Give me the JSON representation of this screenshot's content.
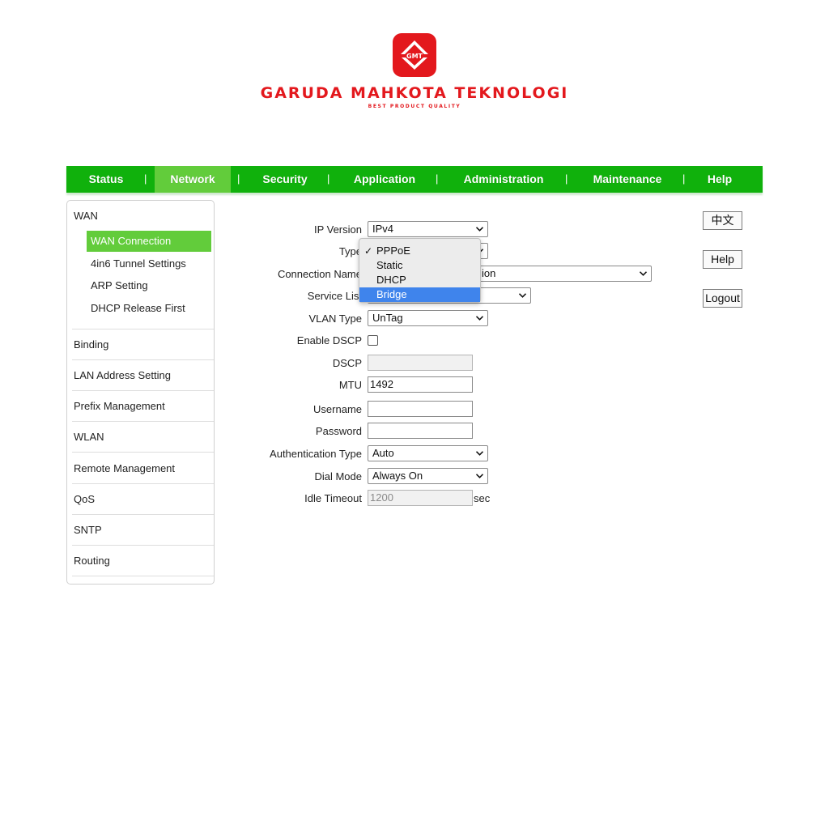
{
  "brand": {
    "logo_text": "GMT",
    "name": "GARUDA MAHKOTA TEKNOLOGI",
    "tagline": "BEST PRODUCT QUALITY",
    "color": "#e3181d"
  },
  "nav": {
    "items": [
      "Status",
      "Network",
      "Security",
      "Application",
      "Administration",
      "Maintenance",
      "Help"
    ],
    "separator": "|",
    "active": "Network",
    "bg_color": "#10b10c",
    "active_color": "#62cc3b"
  },
  "sidebar": {
    "wan": "WAN",
    "wan_items": [
      "WAN Connection",
      "4in6 Tunnel Settings",
      "ARP Setting",
      "DHCP Release First"
    ],
    "active_item": "WAN Connection",
    "groups": [
      "Binding",
      "LAN Address Setting",
      "Prefix Management",
      "WLAN",
      "Remote Management",
      "QoS",
      "SNTP",
      "Routing"
    ]
  },
  "form": {
    "ip_version": {
      "label": "IP Version",
      "value": "IPv4"
    },
    "type": {
      "label": "Type"
    },
    "connection_name": {
      "label": "Connection Name",
      "value_visible_fragment": "ion"
    },
    "service_list": {
      "label": "Service List"
    },
    "vlan_type": {
      "label": "VLAN Type",
      "value": "UnTag"
    },
    "enable_dscp": {
      "label": "Enable DSCP",
      "checked": false
    },
    "dscp": {
      "label": "DSCP",
      "value": ""
    },
    "mtu": {
      "label": "MTU",
      "value": "1492"
    },
    "username": {
      "label": "Username",
      "value": ""
    },
    "password": {
      "label": "Password",
      "value": ""
    },
    "auth_type": {
      "label": "Authentication Type",
      "value": "Auto"
    },
    "dial_mode": {
      "label": "Dial Mode",
      "value": "Always On"
    },
    "idle_timeout": {
      "label": "Idle Timeout",
      "value": "1200",
      "unit": "sec"
    }
  },
  "type_dropdown": {
    "options": [
      "PPPoE",
      "Static",
      "DHCP",
      "Bridge"
    ],
    "selected": "PPPoE",
    "checkmark": "✓",
    "highlighted": "Bridge",
    "highlight_color": "#3f84ec"
  },
  "buttons": {
    "language": "中文",
    "help": "Help",
    "logout": "Logout"
  }
}
